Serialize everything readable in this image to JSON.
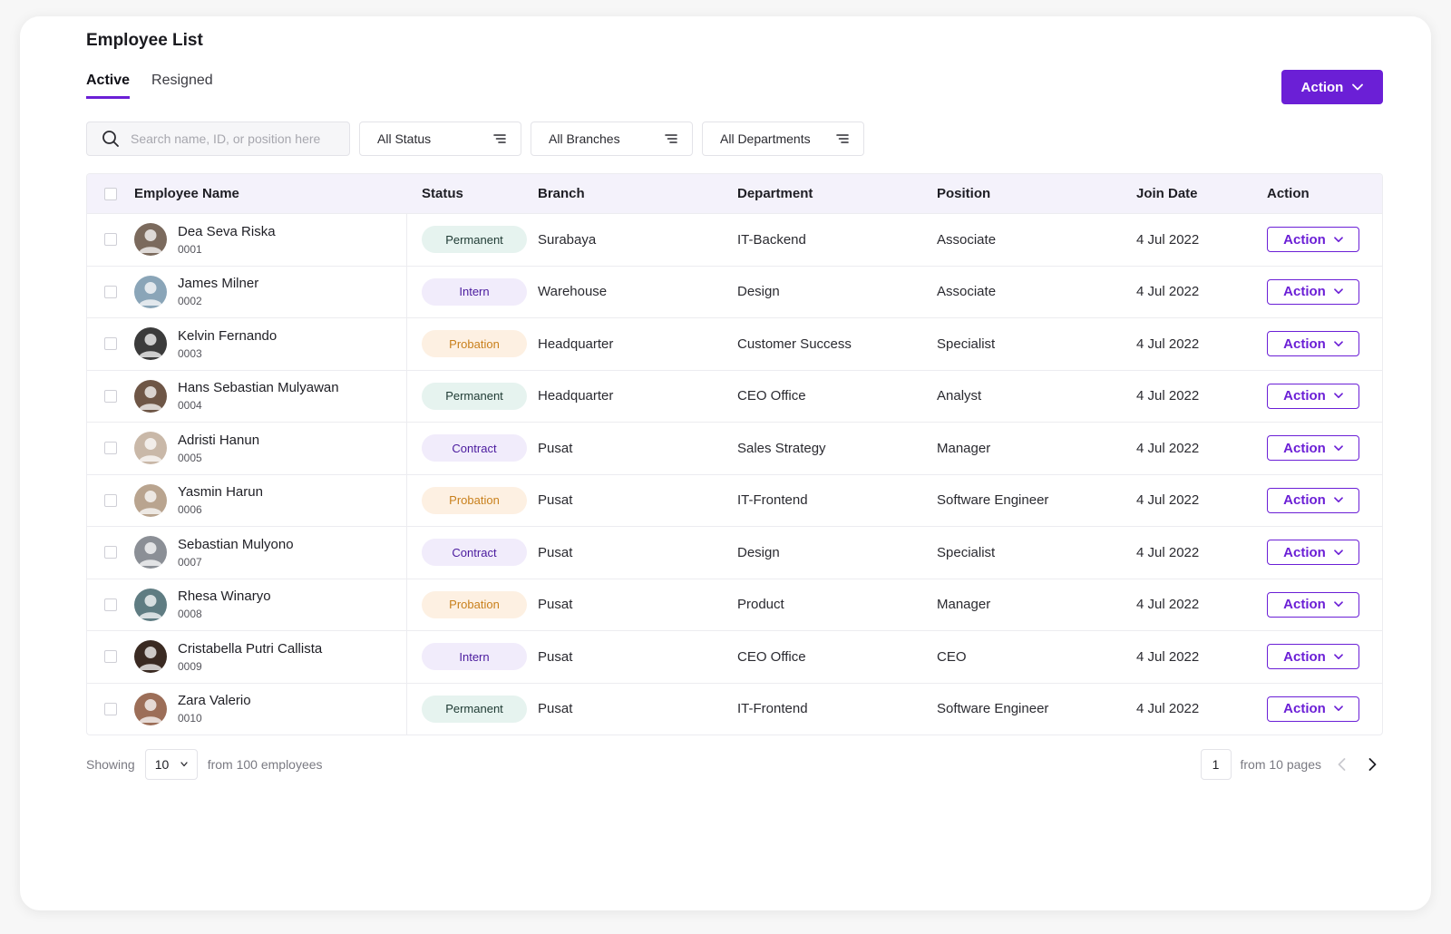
{
  "header": {
    "title": "Employee List",
    "tabs": [
      {
        "label": "Active",
        "active": true
      },
      {
        "label": "Resigned",
        "active": false
      }
    ],
    "action_label": "Action"
  },
  "filters": {
    "search_placeholder": "Search name, ID, or position here",
    "status": "All Status",
    "branch": "All Branches",
    "department": "All Departments"
  },
  "table": {
    "columns": {
      "name": "Employee Name",
      "status": "Status",
      "branch": "Branch",
      "department": "Department",
      "position": "Position",
      "join_date": "Join Date",
      "action": "Action"
    },
    "rows": [
      {
        "name": "Dea Seva Riska",
        "id": "0001",
        "status": "Permanent",
        "branch": "Surabaya",
        "department": "IT-Backend",
        "position": "Associate",
        "join_date": "4 Jul 2022",
        "action": "Action"
      },
      {
        "name": "James Milner",
        "id": "0002",
        "status": "Intern",
        "branch": "Warehouse",
        "department": "Design",
        "position": "Associate",
        "join_date": "4 Jul 2022",
        "action": "Action"
      },
      {
        "name": "Kelvin Fernando",
        "id": "0003",
        "status": "Probation",
        "branch": "Headquarter",
        "department": "Customer Success",
        "position": "Specialist",
        "join_date": "4 Jul 2022",
        "action": "Action"
      },
      {
        "name": "Hans Sebastian Mulyawan",
        "id": "0004",
        "status": "Permanent",
        "branch": "Headquarter",
        "department": "CEO Office",
        "position": "Analyst",
        "join_date": "4 Jul 2022",
        "action": "Action"
      },
      {
        "name": "Adristi Hanun",
        "id": "0005",
        "status": "Contract",
        "branch": "Pusat",
        "department": "Sales Strategy",
        "position": "Manager",
        "join_date": "4 Jul 2022",
        "action": "Action"
      },
      {
        "name": "Yasmin Harun",
        "id": "0006",
        "status": "Probation",
        "branch": "Pusat",
        "department": "IT-Frontend",
        "position": "Software Engineer",
        "join_date": "4 Jul 2022",
        "action": "Action"
      },
      {
        "name": "Sebastian Mulyono",
        "id": "0007",
        "status": "Contract",
        "branch": "Pusat",
        "department": "Design",
        "position": "Specialist",
        "join_date": "4 Jul 2022",
        "action": "Action"
      },
      {
        "name": "Rhesa Winaryo",
        "id": "0008",
        "status": "Probation",
        "branch": "Pusat",
        "department": "Product",
        "position": "Manager",
        "join_date": "4 Jul 2022",
        "action": "Action"
      },
      {
        "name": "Cristabella Putri Callista",
        "id": "0009",
        "status": "Intern",
        "branch": "Pusat",
        "department": "CEO Office",
        "position": "CEO",
        "join_date": "4 Jul 2022",
        "action": "Action"
      },
      {
        "name": "Zara Valerio",
        "id": "0010",
        "status": "Permanent",
        "branch": "Pusat",
        "department": "IT-Frontend",
        "position": "Software Engineer",
        "join_date": "4 Jul 2022",
        "action": "Action"
      }
    ]
  },
  "badge_colors": {
    "Permanent": {
      "bg": "#e6f3ef",
      "fg": "#1e3a33"
    },
    "Intern": {
      "bg": "#f1ecfb",
      "fg": "#4a1a9e"
    },
    "Probation": {
      "bg": "#fdf0e2",
      "fg": "#c9801c"
    },
    "Contract": {
      "bg": "#f1ecfb",
      "fg": "#4a1a9e"
    }
  },
  "avatar_colors": [
    "#7b6a5d",
    "#8aa5b8",
    "#3b3b3b",
    "#6e5646",
    "#c9b8a8",
    "#b9a48f",
    "#8b8f96",
    "#5f7c82",
    "#3a2a22",
    "#9c6e58"
  ],
  "accent_color": "#6b1fd6",
  "pagination": {
    "showing_label": "Showing",
    "page_size": "10",
    "total_label": "from 100 employees",
    "current_page": "1",
    "pages_label": "from 10 pages"
  }
}
